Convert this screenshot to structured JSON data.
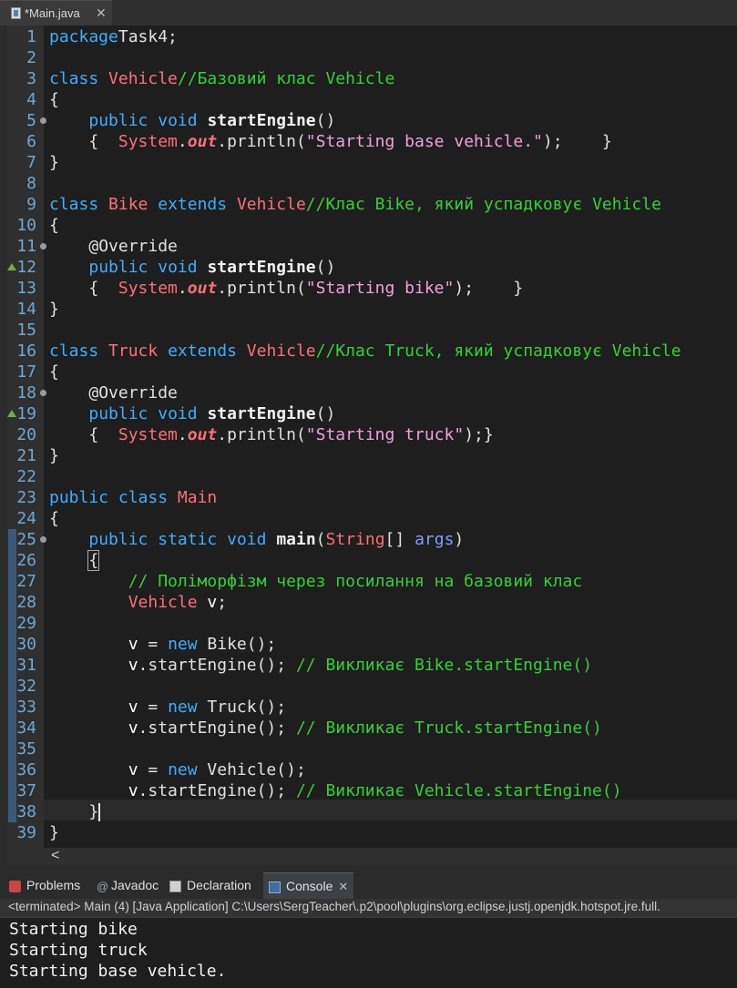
{
  "editor_tab": {
    "label": "*Main.java",
    "close": "✕"
  },
  "code_lines": [
    [
      [
        "kw",
        "package"
      ],
      [
        "",
        "Task4;"
      ]
    ],
    [],
    [
      [
        "kw",
        "class"
      ],
      [
        "",
        " "
      ],
      [
        "cls",
        "Vehicle"
      ],
      [
        "cm",
        "//Базовий клас Vehicle"
      ]
    ],
    [
      [
        "",
        "{"
      ]
    ],
    [
      [
        "",
        "    "
      ],
      [
        "kw",
        "public"
      ],
      [
        "",
        " "
      ],
      [
        "kw",
        "void"
      ],
      [
        "",
        " "
      ],
      [
        "mth",
        "startEngine"
      ],
      [
        "",
        "()"
      ]
    ],
    [
      [
        "",
        "    {  "
      ],
      [
        "cls",
        "System"
      ],
      [
        "",
        "."
      ],
      [
        "fld",
        "out"
      ],
      [
        "",
        ".println("
      ],
      [
        "str",
        "\"Starting base vehicle.\""
      ],
      [
        "",
        ");    }"
      ]
    ],
    [
      [
        "",
        "}"
      ]
    ],
    [],
    [
      [
        "kw",
        "class"
      ],
      [
        "",
        " "
      ],
      [
        "cls",
        "Bike"
      ],
      [
        "",
        " "
      ],
      [
        "kw",
        "extends"
      ],
      [
        "",
        " "
      ],
      [
        "cls",
        "Vehicle"
      ],
      [
        "cm",
        "//Клас Bike, який успадковує Vehicle"
      ]
    ],
    [
      [
        "",
        "{"
      ]
    ],
    [
      [
        "",
        "    "
      ],
      [
        "ann",
        "@Override"
      ]
    ],
    [
      [
        "",
        "    "
      ],
      [
        "kw",
        "public"
      ],
      [
        "",
        " "
      ],
      [
        "kw",
        "void"
      ],
      [
        "",
        " "
      ],
      [
        "mth",
        "startEngine"
      ],
      [
        "",
        "()"
      ]
    ],
    [
      [
        "",
        "    {  "
      ],
      [
        "cls",
        "System"
      ],
      [
        "",
        "."
      ],
      [
        "fld",
        "out"
      ],
      [
        "",
        ".println("
      ],
      [
        "str",
        "\"Starting bike\""
      ],
      [
        "",
        ");    }"
      ]
    ],
    [
      [
        "",
        "}"
      ]
    ],
    [],
    [
      [
        "kw",
        "class"
      ],
      [
        "",
        " "
      ],
      [
        "cls",
        "Truck"
      ],
      [
        "",
        " "
      ],
      [
        "kw",
        "extends"
      ],
      [
        "",
        " "
      ],
      [
        "cls",
        "Vehicle"
      ],
      [
        "cm",
        "//Клас Truck, який успадковує Vehicle"
      ]
    ],
    [
      [
        "",
        "{"
      ]
    ],
    [
      [
        "",
        "    "
      ],
      [
        "ann",
        "@Override"
      ]
    ],
    [
      [
        "",
        "    "
      ],
      [
        "kw",
        "public"
      ],
      [
        "",
        " "
      ],
      [
        "kw",
        "void"
      ],
      [
        "",
        " "
      ],
      [
        "mth",
        "startEngine"
      ],
      [
        "",
        "()"
      ]
    ],
    [
      [
        "",
        "    {  "
      ],
      [
        "cls",
        "System"
      ],
      [
        "",
        "."
      ],
      [
        "fld",
        "out"
      ],
      [
        "",
        ".println("
      ],
      [
        "str",
        "\"Starting truck\""
      ],
      [
        "",
        ");}"
      ]
    ],
    [
      [
        "",
        "}"
      ]
    ],
    [],
    [
      [
        "kw",
        "public"
      ],
      [
        "",
        " "
      ],
      [
        "kw",
        "class"
      ],
      [
        "",
        " "
      ],
      [
        "cls",
        "Main"
      ]
    ],
    [
      [
        "",
        "{"
      ]
    ],
    [
      [
        "",
        "    "
      ],
      [
        "kw",
        "public"
      ],
      [
        "",
        " "
      ],
      [
        "kw",
        "static"
      ],
      [
        "",
        " "
      ],
      [
        "kw",
        "void"
      ],
      [
        "",
        " "
      ],
      [
        "mth",
        "main"
      ],
      [
        "",
        "("
      ],
      [
        "typ",
        "String"
      ],
      [
        "",
        "[] "
      ],
      [
        "param",
        "args"
      ],
      [
        "",
        ")"
      ]
    ],
    [
      [
        "",
        "    "
      ],
      [
        "brace",
        "{"
      ]
    ],
    [
      [
        "",
        "        "
      ],
      [
        "cm",
        "// Поліморфізм через посилання на базовий клас"
      ]
    ],
    [
      [
        "",
        "        "
      ],
      [
        "cls",
        "Vehicle"
      ],
      [
        "",
        " "
      ],
      [
        "var",
        "v"
      ],
      [
        "",
        ";"
      ]
    ],
    [],
    [
      [
        "",
        "        "
      ],
      [
        "var",
        "v"
      ],
      [
        "",
        " = "
      ],
      [
        "kw",
        "new"
      ],
      [
        "",
        " Bike();"
      ]
    ],
    [
      [
        "",
        "        "
      ],
      [
        "var",
        "v"
      ],
      [
        "",
        ".startEngine(); "
      ],
      [
        "cm",
        "// Викликає Bike.startEngine()"
      ]
    ],
    [],
    [
      [
        "",
        "        "
      ],
      [
        "var",
        "v"
      ],
      [
        "",
        " = "
      ],
      [
        "kw",
        "new"
      ],
      [
        "",
        " Truck();"
      ]
    ],
    [
      [
        "",
        "        "
      ],
      [
        "var",
        "v"
      ],
      [
        "",
        ".startEngine(); "
      ],
      [
        "cm",
        "// Викликає Truck.startEngine()"
      ]
    ],
    [],
    [
      [
        "",
        "        "
      ],
      [
        "var",
        "v"
      ],
      [
        "",
        " = "
      ],
      [
        "kw",
        "new"
      ],
      [
        "",
        " Vehicle();"
      ]
    ],
    [
      [
        "",
        "        "
      ],
      [
        "var",
        "v"
      ],
      [
        "",
        ".startEngine(); "
      ],
      [
        "cm",
        "// Викликає Vehicle.startEngine()"
      ]
    ],
    [
      [
        "",
        "    }"
      ],
      [
        "cursor",
        ""
      ]
    ],
    [
      [
        "",
        "}"
      ]
    ]
  ],
  "fold_lines": [
    5,
    11,
    18,
    25
  ],
  "override_lines": [
    12,
    19
  ],
  "scroll_arrow": "<",
  "panel_tabs": [
    {
      "label": "Problems",
      "icon": "problems-icon"
    },
    {
      "label": "Javadoc",
      "icon": "javadoc-icon"
    },
    {
      "label": "Declaration",
      "icon": "declaration-icon"
    },
    {
      "label": "Console",
      "icon": "console-icon",
      "active": true,
      "close": "✕"
    }
  ],
  "console_header": "<terminated> Main (4) [Java Application] C:\\Users\\SergTeacher\\.p2\\pool\\plugins\\org.eclipse.justj.openjdk.hotspot.jre.full.",
  "console_output": [
    "Starting bike",
    "Starting truck",
    "Starting base vehicle."
  ],
  "colors": {
    "keyword": "#3eaeff",
    "class": "#ff6f77",
    "comment": "#35d135",
    "string": "#f0a0e0",
    "line_number": "#6fa7d3"
  }
}
